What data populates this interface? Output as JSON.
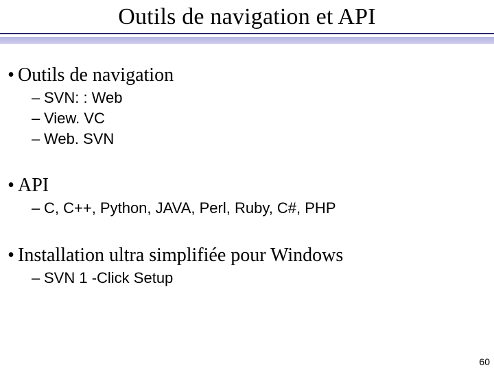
{
  "title": "Outils de navigation et API",
  "sections": [
    {
      "heading": "Outils de navigation",
      "items": [
        "SVN: : Web",
        "View. VC",
        "Web. SVN"
      ]
    },
    {
      "heading": "API",
      "items": [
        "C, C++, Python, JAVA, Perl, Ruby, C#, PHP"
      ]
    },
    {
      "heading": "Installation ultra simplifiée pour Windows",
      "items": [
        "SVN 1 -Click Setup"
      ]
    }
  ],
  "page_number": "60"
}
